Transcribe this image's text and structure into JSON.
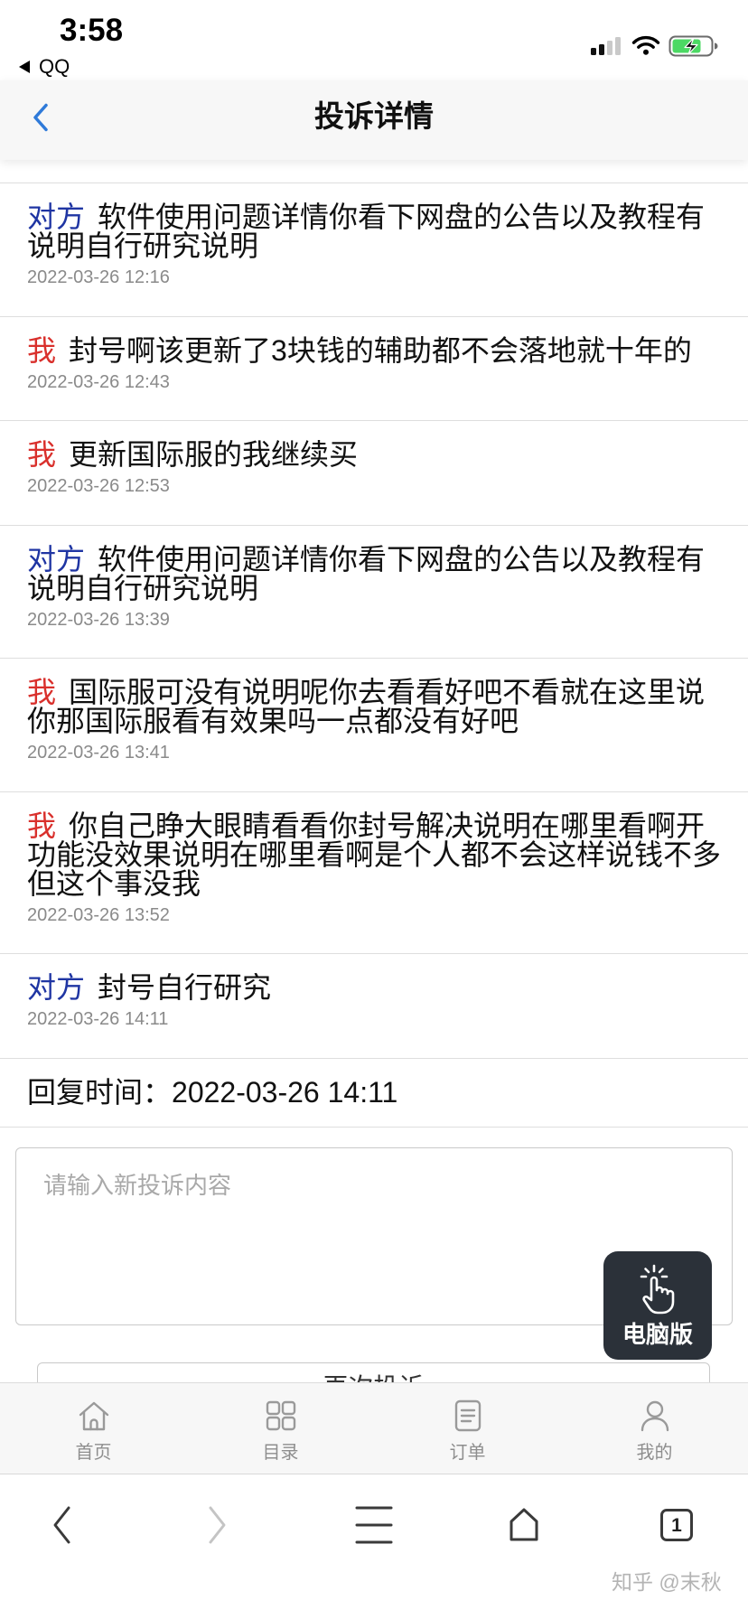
{
  "status_bar": {
    "time": "3:58",
    "back_app": "QQ",
    "icons": [
      "back-triangle-icon",
      "cellular-signal-icon",
      "wifi-icon",
      "battery-charging-icon"
    ]
  },
  "nav": {
    "title": "投诉详情",
    "back_icon": "chevron-left-icon"
  },
  "messages": [
    {
      "sender": "对方",
      "is_self": false,
      "text": "软件使用问题详情你看下网盘的公告以及教程有说明自行研究说明",
      "time": "2022-03-26 12:16"
    },
    {
      "sender": "我",
      "is_self": true,
      "text": "封号啊该更新了3块钱的辅助都不会落地就十年的",
      "time": "2022-03-26 12:43"
    },
    {
      "sender": "我",
      "is_self": true,
      "text": "更新国际服的我继续买",
      "time": "2022-03-26 12:53"
    },
    {
      "sender": "对方",
      "is_self": false,
      "text": "软件使用问题详情你看下网盘的公告以及教程有说明自行研究说明",
      "time": "2022-03-26 13:39"
    },
    {
      "sender": "我",
      "is_self": true,
      "text": "国际服可没有说明呢你去看看好吧不看就在这里说你那国际服看有效果吗一点都没有好吧",
      "time": "2022-03-26 13:41"
    },
    {
      "sender": "我",
      "is_self": true,
      "text": "你自己睁大眼睛看看你封号解决说明在哪里看啊开功能没效果说明在哪里看啊是个人都不会这样说钱不多但这个事没我",
      "time": "2022-03-26 13:52"
    },
    {
      "sender": "对方",
      "is_self": false,
      "text": "封号自行研究",
      "time": "2022-03-26 14:11"
    }
  ],
  "reply": {
    "label": "回复时间：",
    "time": "2022-03-26 14:11"
  },
  "compose": {
    "placeholder": "请输入新投诉内容",
    "submit_label": "再次投诉"
  },
  "desktop_switch": {
    "label": "电脑版",
    "icon": "hand-click-icon"
  },
  "tab_bar": {
    "items": [
      {
        "label": "首页",
        "icon": "home-icon"
      },
      {
        "label": "目录",
        "icon": "grid-icon"
      },
      {
        "label": "订单",
        "icon": "order-list-icon"
      },
      {
        "label": "我的",
        "icon": "user-icon"
      }
    ]
  },
  "browser_toolbar": {
    "tab_count": "1",
    "icons": [
      "back-chevron-icon",
      "forward-chevron-icon",
      "menu-icon",
      "home-icon",
      "tabs-icon"
    ]
  },
  "watermark": "知乎 @末秋",
  "colors": {
    "accent": "#2f7ad9",
    "other_label": "#1f35a3",
    "self_label": "#d9302c",
    "battery": "#4cd964",
    "floating_button": "#2b3139"
  }
}
